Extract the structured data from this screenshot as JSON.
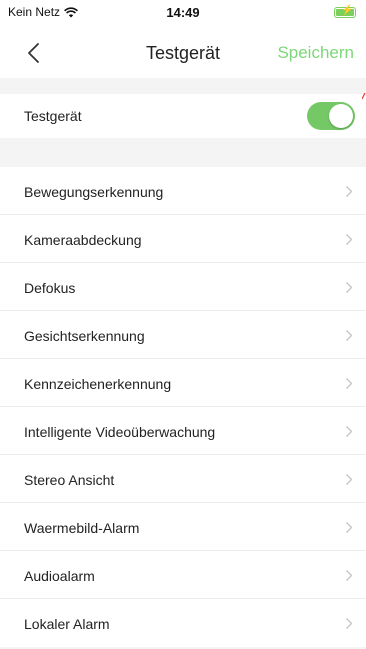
{
  "status": {
    "carrier": "Kein Netz",
    "time": "14:49",
    "wifi_icon": "wifi-icon",
    "battery_icon": "battery-charging-icon"
  },
  "nav": {
    "title": "Testgerät",
    "save_label": "Speichern",
    "back_icon": "chevron-left-icon"
  },
  "device_switch": {
    "label": "Testgerät",
    "enabled": true
  },
  "menu": {
    "items": [
      {
        "label": "Bewegungserkennung"
      },
      {
        "label": "Kameraabdeckung"
      },
      {
        "label": "Defokus"
      },
      {
        "label": "Gesichtserkennung"
      },
      {
        "label": "Kennzeichenerkennung"
      },
      {
        "label": "Intelligente Videoüberwachung"
      },
      {
        "label": "Stereo Ansicht"
      },
      {
        "label": "Waermebild-Alarm"
      },
      {
        "label": "Audioalarm"
      },
      {
        "label": "Lokaler Alarm"
      }
    ]
  },
  "colors": {
    "accent_green": "#7ed67a",
    "toggle_on": "#74c966",
    "background_gray": "#f4f4f4"
  }
}
